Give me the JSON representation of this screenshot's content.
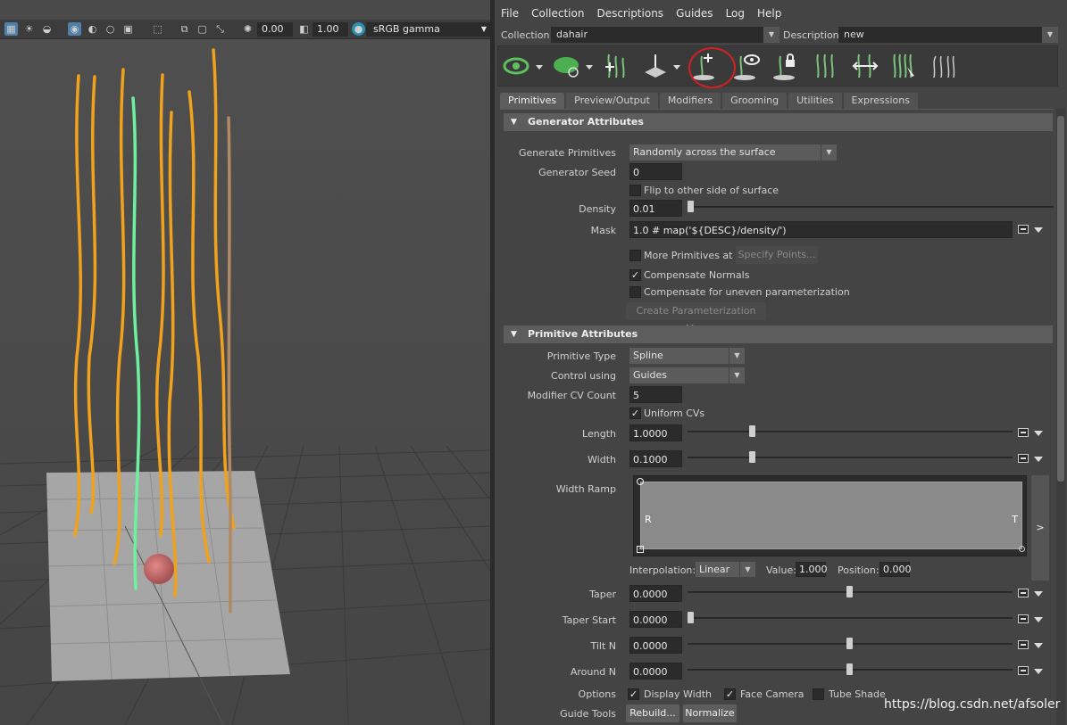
{
  "viewport": {
    "exposure": "0.00",
    "gamma": "1.00",
    "color_space": "sRGB gamma",
    "icons": [
      "checker-icon",
      "light-icon",
      "shadow-icon",
      "camera-icon",
      "isolate-icon",
      "wireframe-icon",
      "grid-icon",
      "select-icon",
      "snapshot-icon",
      "frame-icon",
      "resize-icon",
      "exposure-icon",
      "gamma-icon",
      "colorspace-on-icon"
    ]
  },
  "menubar": [
    "File",
    "Collection",
    "Descriptions",
    "Guides",
    "Log",
    "Help"
  ],
  "collection": {
    "label": "Collection",
    "value": "dahair"
  },
  "description": {
    "label": "Description",
    "value": "new"
  },
  "toolbar_icons": [
    "visibility-eye-icon",
    "preview-leaf-icon",
    "add-guide-icon",
    "place-guide-icon",
    "add-guide-plus-icon",
    "show-guide-icon",
    "lock-guide-icon",
    "rebuild-guides-icon",
    "sculpt-guides-icon",
    "guides-comb-icon",
    "guides-spline-icon"
  ],
  "tabs": [
    "Primitives",
    "Preview/Output",
    "Modifiers",
    "Grooming",
    "Utilities",
    "Expressions"
  ],
  "generator": {
    "title": "Generator Attributes",
    "generate_label": "Generate Primitives",
    "generate_value": "Randomly across the surface",
    "seed_label": "Generator Seed",
    "seed_value": "0",
    "flip_label": "Flip to other side of surface",
    "density_label": "Density",
    "density_value": "0.01",
    "mask_label": "Mask",
    "mask_value": "1.0 # map('${DESC}/density/')",
    "more_label": "More Primitives at",
    "specify_btn": "Specify Points...",
    "compensate_label": "Compensate Normals",
    "compensate_uneven_label": "Compensate for uneven parameterization",
    "create_map_btn": "Create Parameterization Map"
  },
  "primitive": {
    "title": "Primitive Attributes",
    "type_label": "Primitive Type",
    "type_value": "Spline",
    "control_label": "Control using",
    "control_value": "Guides",
    "cv_label": "Modifier CV Count",
    "cv_value": "5",
    "uniform_label": "Uniform CVs",
    "length_label": "Length",
    "length_value": "1.0000",
    "width_label": "Width",
    "width_value": "0.1000",
    "ramp_label": "Width Ramp",
    "ramp_left": "R",
    "ramp_right": "T",
    "ramp_expand": ">",
    "interp_label": "Interpolation:",
    "interp_value": "Linear",
    "value_label": "Value:",
    "value_value": "1.000",
    "position_label": "Position:",
    "position_value": "0.000",
    "taper_label": "Taper",
    "taper_value": "0.0000",
    "taper_start_label": "Taper Start",
    "taper_start_value": "0.0000",
    "tilt_label": "Tilt N",
    "tilt_value": "0.0000",
    "around_label": "Around N",
    "around_value": "0.0000",
    "options_label": "Options",
    "display_width_label": "Display Width",
    "face_camera_label": "Face Camera",
    "tube_shade_label": "Tube Shade",
    "guide_tools_label": "Guide Tools",
    "rebuild_btn": "Rebuild...",
    "normalize_btn": "Normalize"
  },
  "watermark": "https://blog.csdn.net/afsoler",
  "colors": {
    "hair_orange": "#f0a21c",
    "hair_green": "#6ef0a0",
    "hair_brown": "#b08a64",
    "accent_red": "#d42020"
  }
}
